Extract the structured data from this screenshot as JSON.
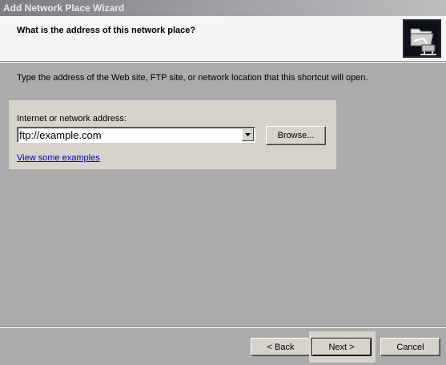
{
  "window": {
    "title": "Add Network Place Wizard"
  },
  "header": {
    "title": "What is the address of this network place?",
    "icon": "network-folder-icon"
  },
  "intro": "Type the address of the Web site, FTP site, or network location that this shortcut will open.",
  "address": {
    "label": "Internet or network address:",
    "value": "ftp://example.com",
    "browse_label": "Browse...",
    "examples_link": "View some examples"
  },
  "footer": {
    "back_label": "< Back",
    "next_label": "Next >",
    "cancel_label": "Cancel"
  }
}
